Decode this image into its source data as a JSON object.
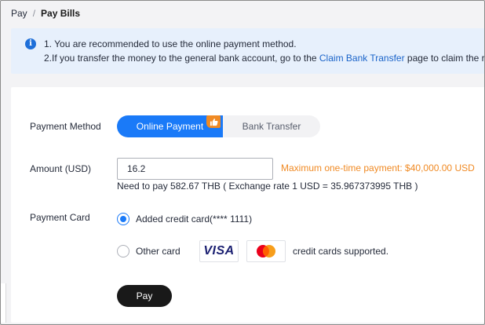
{
  "breadcrumb": {
    "parent": "Pay",
    "separator": "/",
    "current": "Pay Bills"
  },
  "notice": {
    "icon": "info-icon",
    "line1": "1. You are recommended to use the online payment method.",
    "line2_prefix": "2.If you transfer the money to the general bank account, go to the ",
    "line2_link": "Claim Bank Transfer",
    "line2_suffix": " page to claim the r"
  },
  "form": {
    "payment_method": {
      "label": "Payment Method",
      "options": [
        "Online Payment",
        "Bank Transfer"
      ],
      "selected": "Online Payment",
      "badge_icon": "thumbs-up-icon"
    },
    "amount": {
      "label": "Amount (USD)",
      "value": "16.2",
      "max_note": "Maximum one-time payment: $40,000.00 USD",
      "need_to_pay": "Need to pay 582.67 THB ( Exchange rate 1 USD = 35.967373995 THB )"
    },
    "payment_card": {
      "label": "Payment Card",
      "added_card": "Added credit card(**** 1111)",
      "other_card": "Other card",
      "selected": "added_card",
      "logos": [
        "visa-logo",
        "mastercard-logo"
      ],
      "visa_text": "VISA",
      "supported_note": "credit cards supported."
    },
    "pay_button": "Pay"
  },
  "colors": {
    "accent": "#1a7af8",
    "warning": "#f08a24",
    "link": "#1a63c9",
    "notice_bg": "#e7f0fc",
    "pay_button_bg": "#191919"
  }
}
